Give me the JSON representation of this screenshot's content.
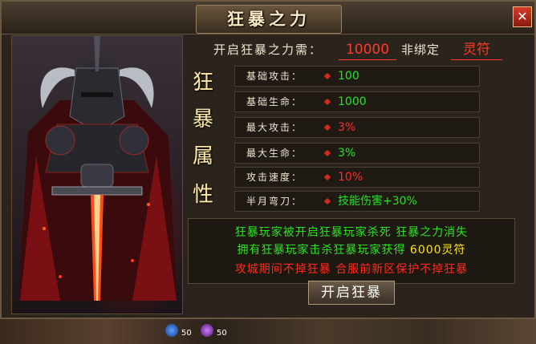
{
  "dialog": {
    "title": "狂暴之力",
    "close_glyph": "✕"
  },
  "requirement": {
    "label": "开启狂暴之力需：",
    "amount": "10000",
    "unbind_label": "非绑定",
    "item": "灵符"
  },
  "side_title": [
    "狂",
    "暴",
    "属",
    "性"
  ],
  "attributes": [
    {
      "label": "基础攻击：",
      "value": "100",
      "color": "#21e421"
    },
    {
      "label": "基础生命：",
      "value": "1000",
      "color": "#21e421"
    },
    {
      "label": "最大攻击：",
      "value": "3%",
      "color": "#ff2a2a"
    },
    {
      "label": "最大生命：",
      "value": "3%",
      "color": "#21e421"
    },
    {
      "label": "攻击速度：",
      "value": "10%",
      "color": "#ff2a2a"
    },
    {
      "label": "半月弯刀：",
      "value": "技能伤害+30%",
      "color": "#21e421"
    }
  ],
  "info": {
    "line1": "狂暴玩家被开启狂暴玩家杀死 狂暴之力消失",
    "line2_prefix": "拥有狂暴玩家击杀狂暴玩家获得 ",
    "line2_reward": "6000灵符",
    "line3": "攻城期间不掉狂暴 合服前新区保护不掉狂暴"
  },
  "button": {
    "open_label": "开启狂暴"
  },
  "hud": {
    "count1": "50",
    "count2": "50"
  }
}
